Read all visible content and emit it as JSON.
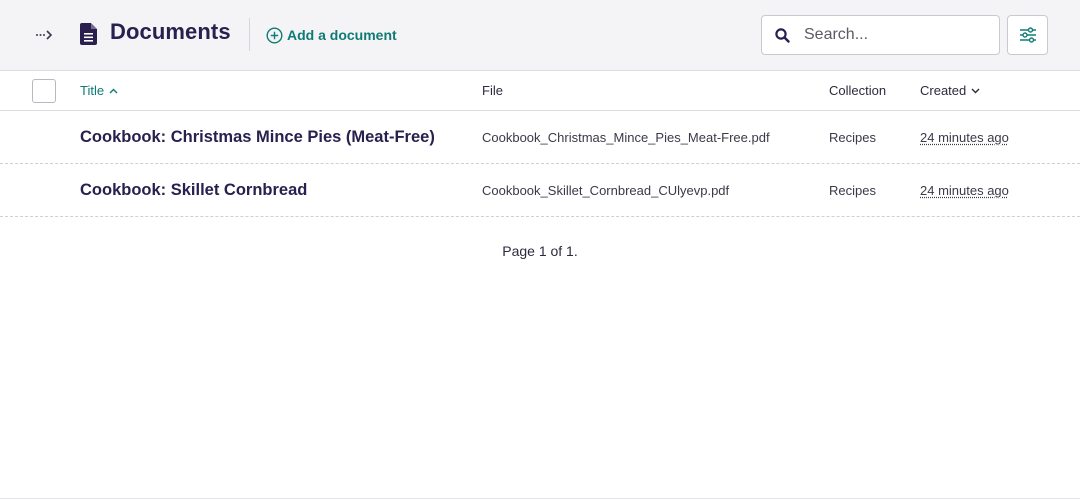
{
  "header": {
    "title": "Documents",
    "add_document_label": "Add a document",
    "search": {
      "placeholder": "Search...",
      "value": ""
    }
  },
  "table": {
    "columns": [
      "Title",
      "File",
      "Collection",
      "Created"
    ],
    "rows": [
      {
        "title": "Cookbook: Christmas Mince Pies (Meat-Free)",
        "file": "Cookbook_Christmas_Mince_Pies_Meat-Free.pdf",
        "collection": "Recipes",
        "created": "24 minutes ago"
      },
      {
        "title": "Cookbook: Skillet Cornbread",
        "file": "Cookbook_Skillet_Cornbread_CUlyevp.pdf",
        "collection": "Recipes",
        "created": "24 minutes ago"
      }
    ]
  },
  "pagination": {
    "text": "Page 1 of 1."
  },
  "icons": {
    "toggle": "sidebar-toggle-icon",
    "document": "document-icon",
    "add": "plus-circle-icon",
    "search": "search-icon",
    "filter": "sliders-icon",
    "sort_title": "chevron-up-icon",
    "sort_created": "chevron-down-icon"
  },
  "colors": {
    "accent": "#0f7b74",
    "heading": "#29204f",
    "header_bg": "#f4f4f6"
  }
}
